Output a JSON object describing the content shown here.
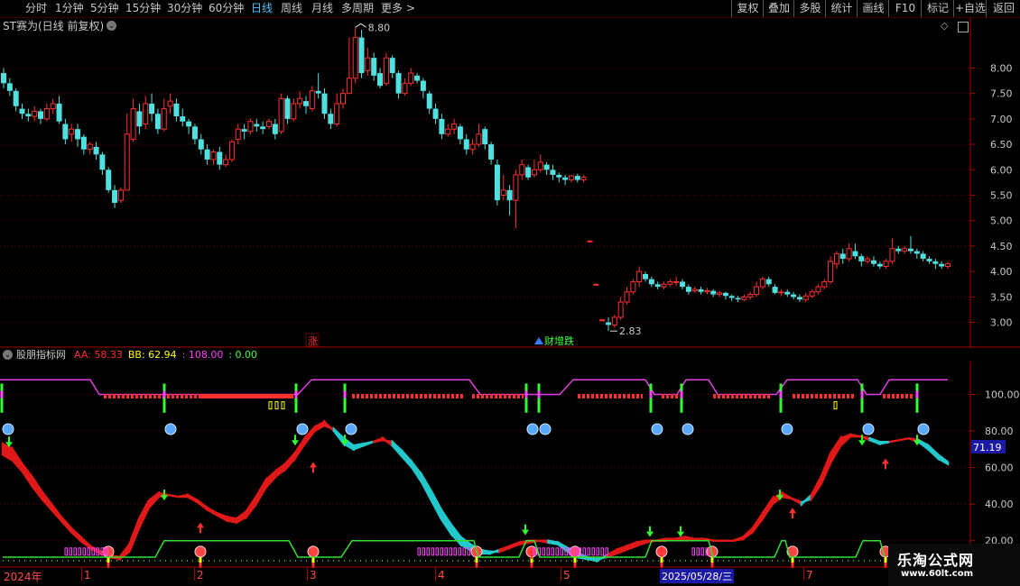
{
  "toolbar": {
    "left": [
      {
        "label": "分时",
        "active": false
      },
      {
        "label": "1分钟",
        "active": false
      },
      {
        "label": "5分钟",
        "active": false
      },
      {
        "label": "15分钟",
        "active": false
      },
      {
        "label": "30分钟",
        "active": false
      },
      {
        "label": "60分钟",
        "active": false
      },
      {
        "label": "日线",
        "active": true
      },
      {
        "label": "周线",
        "active": false
      },
      {
        "label": "月线",
        "active": false
      },
      {
        "label": "多周期",
        "active": false
      },
      {
        "label": "更多",
        "active": false
      }
    ],
    "more_arrow": ">",
    "right": [
      "复权",
      "叠加",
      "多股",
      "统计",
      "画线",
      "F10",
      "标记",
      "+自选",
      "返回"
    ]
  },
  "main_chart": {
    "title": "ST赛为(日线 前复权)",
    "y_ticks": [
      "8.00",
      "7.50",
      "7.00",
      "6.50",
      "6.00",
      "5.50",
      "5.00",
      "4.50",
      "4.00",
      "3.50",
      "3.00"
    ],
    "high_label": "8.80",
    "low_label": "2.83",
    "markers": {
      "zhang": "涨",
      "bottom": "财增跌"
    },
    "colors": {
      "up": "#ff3030",
      "down": "#4fe0e0",
      "grid": "#6a0000"
    },
    "chart_data": {
      "type": "candlestick",
      "ylim": [
        2.55,
        9.0
      ],
      "candles": [
        [
          7.9,
          7.7,
          8.0,
          7.6
        ],
        [
          7.7,
          7.55,
          7.8,
          7.45
        ],
        [
          7.55,
          7.25,
          7.6,
          7.15
        ],
        [
          7.2,
          7.1,
          7.3,
          7.0
        ],
        [
          7.1,
          7.05,
          7.2,
          6.95
        ],
        [
          7.05,
          7.15,
          7.25,
          6.95
        ],
        [
          7.15,
          7.0,
          7.2,
          6.9
        ],
        [
          7.0,
          7.2,
          7.3,
          6.95
        ],
        [
          7.2,
          7.3,
          7.4,
          7.1
        ],
        [
          7.3,
          6.95,
          7.45,
          6.9
        ],
        [
          6.9,
          6.6,
          7.0,
          6.5
        ],
        [
          6.7,
          6.8,
          6.9,
          6.55
        ],
        [
          6.8,
          6.6,
          6.9,
          6.45
        ],
        [
          6.65,
          6.4,
          6.7,
          6.3
        ],
        [
          6.4,
          6.5,
          6.55,
          6.3
        ],
        [
          6.45,
          6.3,
          6.55,
          6.2
        ],
        [
          6.3,
          6.0,
          6.35,
          5.9
        ],
        [
          6.0,
          5.6,
          6.05,
          5.55
        ],
        [
          5.6,
          5.35,
          5.7,
          5.25
        ],
        [
          5.4,
          5.6,
          5.65,
          5.35
        ],
        [
          5.6,
          6.7,
          7.1,
          5.6
        ],
        [
          6.6,
          7.2,
          7.4,
          6.55
        ],
        [
          7.15,
          6.85,
          7.3,
          6.7
        ],
        [
          6.9,
          7.3,
          7.45,
          6.8
        ],
        [
          7.3,
          7.1,
          7.5,
          6.95
        ],
        [
          7.1,
          6.8,
          7.2,
          6.7
        ],
        [
          6.8,
          7.2,
          7.4,
          6.75
        ],
        [
          7.25,
          7.35,
          7.5,
          7.1
        ],
        [
          7.3,
          7.05,
          7.4,
          6.95
        ],
        [
          7.05,
          6.95,
          7.2,
          6.85
        ],
        [
          6.95,
          6.85,
          7.0,
          6.7
        ],
        [
          6.85,
          6.6,
          6.9,
          6.5
        ],
        [
          6.6,
          6.4,
          6.7,
          6.3
        ],
        [
          6.4,
          6.2,
          6.5,
          6.1
        ],
        [
          6.2,
          6.35,
          6.4,
          6.1
        ],
        [
          6.35,
          6.1,
          6.45,
          6.0
        ],
        [
          6.1,
          6.2,
          6.3,
          6.05
        ],
        [
          6.2,
          6.55,
          6.6,
          6.15
        ],
        [
          6.6,
          6.8,
          6.9,
          6.5
        ],
        [
          6.8,
          6.75,
          6.9,
          6.6
        ],
        [
          6.75,
          6.95,
          7.0,
          6.7
        ],
        [
          6.9,
          6.85,
          7.0,
          6.75
        ],
        [
          6.85,
          6.8,
          6.95,
          6.7
        ],
        [
          6.85,
          6.95,
          7.0,
          6.8
        ],
        [
          6.9,
          6.7,
          7.0,
          6.6
        ],
        [
          6.75,
          7.4,
          7.5,
          6.7
        ],
        [
          7.4,
          7.0,
          7.45,
          6.9
        ],
        [
          7.0,
          7.3,
          7.4,
          6.95
        ],
        [
          7.3,
          7.4,
          7.55,
          7.2
        ],
        [
          7.35,
          7.25,
          7.45,
          7.1
        ],
        [
          7.2,
          7.55,
          7.65,
          7.15
        ],
        [
          7.55,
          7.5,
          7.9,
          7.4
        ],
        [
          7.5,
          7.1,
          7.6,
          7.0
        ],
        [
          7.1,
          6.9,
          7.2,
          6.8
        ],
        [
          6.9,
          7.3,
          7.5,
          6.85
        ],
        [
          7.3,
          7.5,
          7.6,
          7.2
        ],
        [
          7.5,
          7.8,
          8.6,
          7.5
        ],
        [
          7.8,
          8.6,
          8.8,
          7.7
        ],
        [
          8.6,
          7.9,
          8.75,
          7.8
        ],
        [
          7.95,
          8.2,
          8.4,
          7.85
        ],
        [
          8.2,
          7.85,
          8.3,
          7.75
        ],
        [
          7.9,
          7.65,
          8.0,
          7.6
        ],
        [
          7.7,
          8.2,
          8.3,
          7.65
        ],
        [
          8.2,
          7.9,
          8.25,
          7.8
        ],
        [
          7.9,
          7.5,
          7.95,
          7.4
        ],
        [
          7.5,
          7.7,
          7.8,
          7.45
        ],
        [
          7.7,
          7.9,
          8.0,
          7.65
        ],
        [
          7.85,
          7.75,
          7.9,
          7.7
        ],
        [
          7.75,
          7.55,
          7.8,
          7.4
        ],
        [
          7.5,
          7.2,
          7.55,
          7.1
        ],
        [
          7.2,
          7.0,
          7.3,
          6.9
        ],
        [
          7.0,
          6.7,
          7.1,
          6.6
        ],
        [
          6.7,
          6.8,
          6.9,
          6.65
        ],
        [
          6.8,
          6.9,
          7.0,
          6.7
        ],
        [
          6.85,
          6.6,
          6.9,
          6.5
        ],
        [
          6.6,
          6.4,
          6.7,
          6.3
        ],
        [
          6.4,
          6.5,
          6.6,
          6.3
        ],
        [
          6.5,
          6.7,
          6.9,
          6.45
        ],
        [
          6.8,
          6.5,
          6.85,
          6.4
        ],
        [
          6.5,
          6.2,
          6.55,
          6.1
        ],
        [
          6.1,
          5.4,
          6.2,
          5.3
        ],
        [
          5.5,
          5.6,
          5.9,
          5.4
        ],
        [
          5.6,
          5.4,
          5.7,
          5.1
        ],
        [
          5.4,
          5.9,
          6.0,
          4.85
        ],
        [
          5.9,
          6.1,
          6.2,
          5.8
        ],
        [
          6.05,
          5.85,
          6.1,
          5.8
        ],
        [
          5.9,
          6.0,
          6.2,
          5.85
        ],
        [
          6.0,
          6.15,
          6.3,
          5.95
        ],
        [
          6.1,
          6.0,
          6.15,
          5.9
        ],
        [
          6.0,
          5.9,
          6.1,
          5.8
        ],
        [
          5.9,
          5.85,
          5.95,
          5.75
        ],
        [
          5.85,
          5.8,
          5.9,
          5.7
        ],
        [
          5.8,
          5.88,
          5.9,
          5.75
        ],
        [
          5.88,
          5.8,
          5.92,
          5.75
        ],
        [
          5.8,
          5.85,
          5.9,
          5.75
        ],
        [
          4.6,
          4.6,
          4.61,
          4.59
        ],
        [
          3.75,
          3.75,
          3.76,
          3.74
        ],
        [
          3.05,
          3.05,
          3.06,
          3.04
        ],
        [
          3.0,
          2.95,
          3.1,
          2.83
        ],
        [
          2.95,
          3.1,
          3.15,
          2.9
        ],
        [
          3.1,
          3.4,
          3.5,
          3.05
        ],
        [
          3.4,
          3.6,
          3.7,
          3.35
        ],
        [
          3.6,
          3.8,
          3.85,
          3.55
        ],
        [
          3.8,
          4.0,
          4.1,
          3.7
        ],
        [
          3.95,
          3.85,
          4.0,
          3.8
        ],
        [
          3.85,
          3.75,
          3.9,
          3.7
        ],
        [
          3.75,
          3.7,
          3.8,
          3.65
        ],
        [
          3.7,
          3.75,
          3.8,
          3.65
        ],
        [
          3.75,
          3.8,
          3.85,
          3.7
        ],
        [
          3.8,
          3.8,
          3.9,
          3.72
        ],
        [
          3.8,
          3.7,
          3.85,
          3.65
        ],
        [
          3.7,
          3.6,
          3.75,
          3.55
        ],
        [
          3.62,
          3.65,
          3.7,
          3.58
        ],
        [
          3.65,
          3.6,
          3.7,
          3.55
        ],
        [
          3.6,
          3.62,
          3.68,
          3.55
        ],
        [
          3.62,
          3.55,
          3.65,
          3.5
        ],
        [
          3.55,
          3.58,
          3.62,
          3.5
        ],
        [
          3.58,
          3.52,
          3.6,
          3.45
        ],
        [
          3.52,
          3.48,
          3.55,
          3.42
        ],
        [
          3.48,
          3.45,
          3.52,
          3.4
        ],
        [
          3.45,
          3.5,
          3.55,
          3.42
        ],
        [
          3.5,
          3.55,
          3.6,
          3.45
        ],
        [
          3.55,
          3.7,
          3.8,
          3.5
        ],
        [
          3.7,
          3.85,
          3.9,
          3.65
        ],
        [
          3.85,
          3.75,
          3.9,
          3.7
        ],
        [
          3.7,
          3.58,
          3.75,
          3.55
        ],
        [
          3.58,
          3.6,
          3.65,
          3.52
        ],
        [
          3.6,
          3.55,
          3.65,
          3.5
        ],
        [
          3.55,
          3.5,
          3.6,
          3.45
        ],
        [
          3.5,
          3.45,
          3.55,
          3.4
        ],
        [
          3.45,
          3.52,
          3.58,
          3.4
        ],
        [
          3.52,
          3.6,
          3.65,
          3.48
        ],
        [
          3.6,
          3.7,
          3.75,
          3.55
        ],
        [
          3.7,
          3.8,
          3.85,
          3.65
        ],
        [
          3.8,
          4.2,
          4.3,
          3.75
        ],
        [
          4.15,
          4.35,
          4.4,
          4.05
        ],
        [
          4.35,
          4.25,
          4.45,
          4.15
        ],
        [
          4.25,
          4.45,
          4.55,
          4.2
        ],
        [
          4.4,
          4.3,
          4.55,
          4.25
        ],
        [
          4.3,
          4.2,
          4.35,
          4.1
        ],
        [
          4.2,
          4.25,
          4.3,
          4.15
        ],
        [
          4.22,
          4.15,
          4.3,
          4.1
        ],
        [
          4.15,
          4.1,
          4.2,
          4.05
        ],
        [
          4.1,
          4.2,
          4.25,
          4.05
        ],
        [
          4.2,
          4.45,
          4.65,
          4.15
        ],
        [
          4.45,
          4.4,
          4.5,
          4.35
        ],
        [
          4.4,
          4.45,
          4.5,
          4.35
        ],
        [
          4.45,
          4.4,
          4.7,
          4.35
        ],
        [
          4.4,
          4.35,
          4.45,
          4.25
        ],
        [
          4.35,
          4.25,
          4.4,
          4.2
        ],
        [
          4.25,
          4.2,
          4.3,
          4.15
        ],
        [
          4.2,
          4.15,
          4.25,
          4.05
        ],
        [
          4.15,
          4.1,
          4.2,
          4.05
        ],
        [
          4.1,
          4.15,
          4.2,
          4.05
        ]
      ]
    }
  },
  "indicator": {
    "name": "股朋指标网",
    "labels": [
      {
        "text": "AA: 58.33",
        "color": "#ff3030"
      },
      {
        "text": "BB: 62.94",
        "color": "#ffff00"
      },
      {
        "text": ": 108.00",
        "color": "#ff40ff"
      },
      {
        "text": ": 0.00",
        "color": "#40ff40"
      }
    ],
    "y_ticks": [
      "100.00",
      "80.00",
      "60.00",
      "40.00",
      "20.00"
    ],
    "current_value": "71.19",
    "chart_data": {
      "type": "area",
      "ylim": [
        10,
        118
      ],
      "aa": [
        73,
        70,
        62,
        55,
        47,
        40,
        33,
        27,
        22,
        17,
        14,
        12,
        11,
        18,
        32,
        42,
        46,
        45,
        44,
        45,
        42,
        38,
        35,
        33,
        32,
        36,
        44,
        53,
        58,
        62,
        68,
        76,
        82,
        85,
        80,
        73,
        70,
        72,
        74,
        76,
        72,
        66,
        60,
        52,
        42,
        32,
        24,
        18,
        15,
        13,
        13,
        15,
        17,
        19,
        20,
        20,
        19,
        18,
        14,
        11,
        10,
        9,
        12,
        15,
        17,
        19,
        20,
        20,
        21,
        21,
        22,
        21,
        21,
        20,
        20,
        20,
        22,
        27,
        35,
        43,
        46,
        43,
        40,
        45,
        55,
        68,
        76,
        78,
        77,
        75,
        73,
        74,
        75,
        76,
        74,
        70,
        65,
        62
      ],
      "bb": [
        67,
        64,
        58,
        50,
        43,
        37,
        31,
        25,
        20,
        16,
        13,
        11,
        10,
        14,
        27,
        38,
        44,
        45,
        44,
        44,
        41,
        37,
        34,
        31,
        30,
        33,
        40,
        49,
        55,
        59,
        65,
        73,
        80,
        83,
        81,
        76,
        72,
        73,
        74,
        75,
        74,
        69,
        63,
        56,
        47,
        37,
        29,
        22,
        18,
        15,
        14,
        14,
        16,
        18,
        19,
        20,
        20,
        19,
        16,
        13,
        11,
        10,
        11,
        13,
        15,
        17,
        19,
        20,
        20,
        21,
        21,
        21,
        21,
        20,
        20,
        20,
        21,
        25,
        32,
        40,
        44,
        43,
        41,
        43,
        51,
        63,
        72,
        77,
        77,
        76,
        74,
        74,
        75,
        76,
        75,
        72,
        67,
        63
      ],
      "upper_signals_x": [
        2,
        182,
        328,
        382,
        583,
        597,
        721,
        755,
        865,
        955,
        1016
      ],
      "lower_signals_x": [
        120,
        222,
        347,
        528,
        589,
        637,
        733,
        789,
        878,
        981
      ],
      "date_labels": [
        "2024年",
        "1",
        "2",
        "3",
        "4",
        "5",
        "7"
      ],
      "highlight_date": "2025/05/28/三"
    }
  },
  "watermark": {
    "big": "乐淘公式网",
    "small": "www.60lt.com"
  }
}
